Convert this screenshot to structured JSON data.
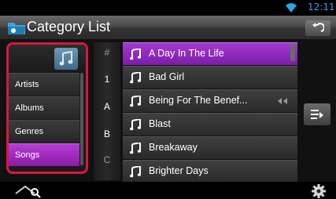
{
  "status": {
    "time": "12:11",
    "icon": "wifi-icon"
  },
  "header": {
    "title": "Category List",
    "back_icon": "back-arrow-icon"
  },
  "categories": {
    "items": [
      {
        "label": "Artists",
        "selected": false
      },
      {
        "label": "Albums",
        "selected": false
      },
      {
        "label": "Genres",
        "selected": false
      },
      {
        "label": "Songs",
        "selected": true
      }
    ],
    "highlight_color": "#d8173f"
  },
  "index": {
    "letters": [
      "#",
      "1",
      "A",
      "B",
      "C"
    ],
    "active": [
      "1",
      "A",
      "B"
    ]
  },
  "songs": [
    {
      "title": "A Day In The Life",
      "selected": true
    },
    {
      "title": "Bad Girl",
      "selected": false
    },
    {
      "title": "Being For The Benef...",
      "selected": false,
      "extra_icon": "scroll-text-icon"
    },
    {
      "title": "Blast",
      "selected": false
    },
    {
      "title": "Breakaway",
      "selected": false
    },
    {
      "title": "Brighter Days",
      "selected": false
    }
  ],
  "colors": {
    "selected": "#9a2fc7",
    "accent": "#25a9e0"
  },
  "bottom": {
    "left_icon": "search-icon",
    "right_icon": "settings-gear-icon"
  }
}
